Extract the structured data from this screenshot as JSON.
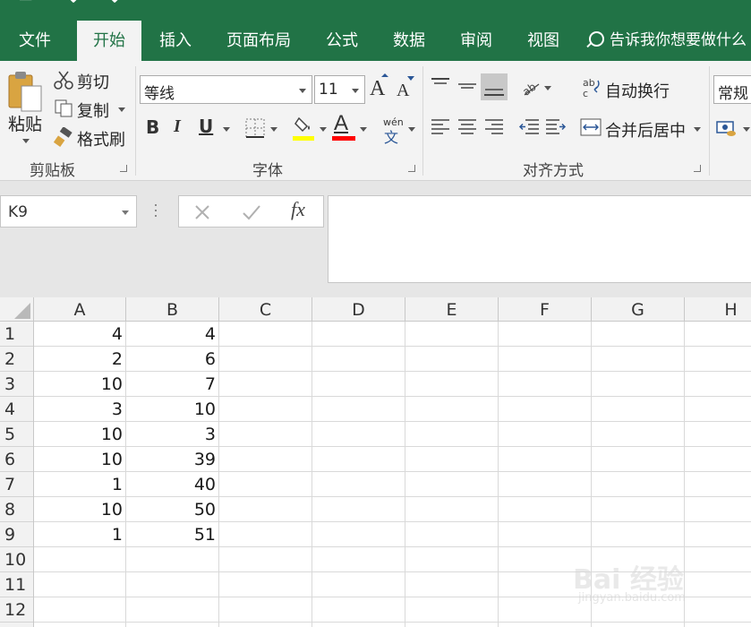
{
  "ribbon_tabs": [
    "文件",
    "开始",
    "插入",
    "页面布局",
    "公式",
    "数据",
    "审阅",
    "视图"
  ],
  "tell_me": "告诉我你想要做什么",
  "clipboard": {
    "paste": "粘贴",
    "cut": "剪切",
    "copy": "复制",
    "format_painter": "格式刷",
    "group": "剪贴板"
  },
  "font": {
    "name": "等线",
    "size": "11",
    "grow": "A",
    "shrink": "A",
    "bold": "B",
    "italic": "I",
    "underline": "U",
    "phonetic_top": "wén",
    "phonetic_bottom": "文",
    "highlight_color": "#ffff00",
    "font_color": "#ff0000",
    "group": "字体"
  },
  "alignment": {
    "wrap": "自动换行",
    "merge": "合并后居中",
    "group": "对齐方式"
  },
  "number": {
    "format": "常规"
  },
  "formula_bar": {
    "name_box": "K9",
    "fx": "fx",
    "content": ""
  },
  "sheet": {
    "columns": [
      "A",
      "B",
      "C",
      "D",
      "E",
      "F",
      "G",
      "H"
    ],
    "rows": [
      "1",
      "2",
      "3",
      "4",
      "5",
      "6",
      "7",
      "8",
      "9",
      "10",
      "11",
      "12"
    ],
    "col_a": [
      "4",
      "2",
      "10",
      "3",
      "10",
      "10",
      "1",
      "10",
      "1"
    ],
    "col_b": [
      "4",
      "6",
      "7",
      "10",
      "3",
      "39",
      "40",
      "50",
      "51"
    ]
  },
  "watermark": {
    "brand": "Bai 经验",
    "url": "jingyan.baidu.com"
  },
  "colors": {
    "accent": "#217346",
    "ribbon_bg": "#f3f3f3"
  }
}
